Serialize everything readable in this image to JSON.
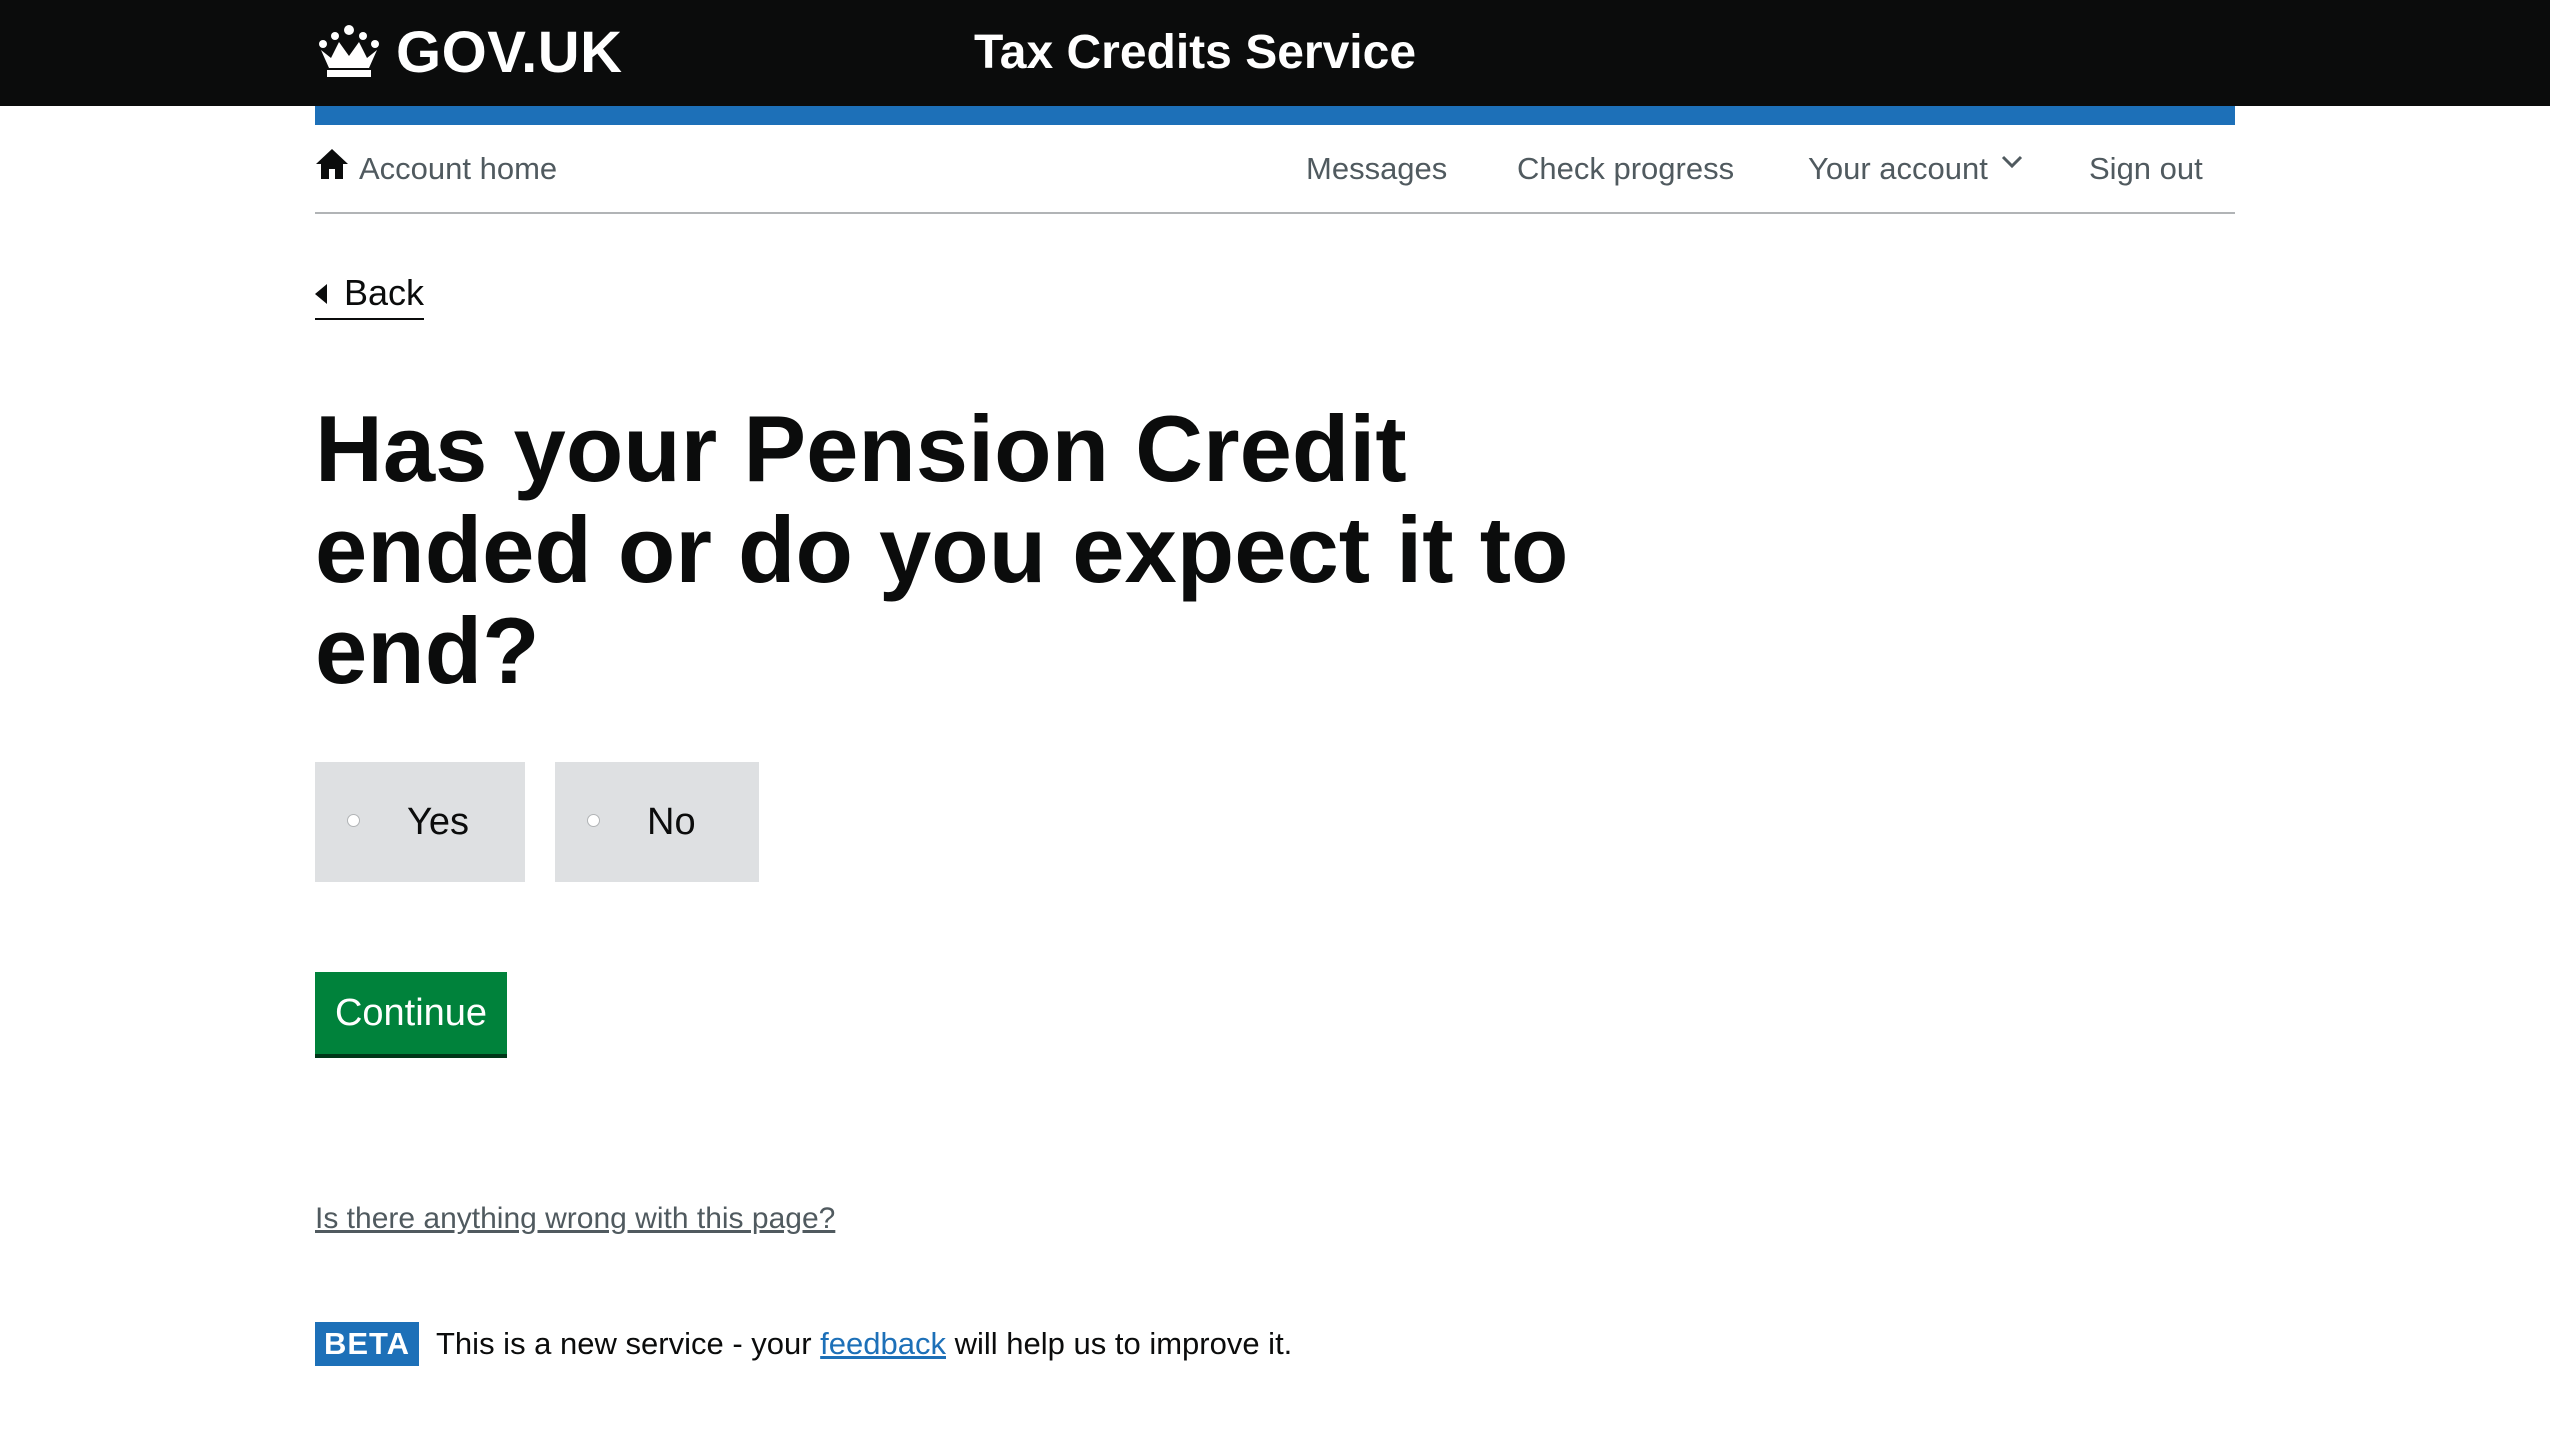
{
  "header": {
    "logo_text": "GOV.UK",
    "service_name": "Tax Credits Service",
    "accent_color": "#1d70b8"
  },
  "subnav": {
    "home_label": "Account home",
    "messages_label": "Messages",
    "progress_label": "Check progress",
    "account_label": "Your account",
    "signout_label": "Sign out"
  },
  "back_label": "Back",
  "question": "Has your Pension Credit ended or do you expect it to end?",
  "options": [
    {
      "label": "Yes",
      "selected": false
    },
    {
      "label": "No",
      "selected": false
    }
  ],
  "continue_label": "Continue",
  "continue_color": "#00823b",
  "problem_link": "Is there anything wrong with this page?",
  "beta": {
    "tag": "BETA",
    "text_before": "This is a new service  - your ",
    "link": "feedback",
    "text_after": " will help us to improve it."
  },
  "icons": {
    "logo": "crown-icon",
    "home": "home-icon",
    "account_menu": "chevron-down-icon",
    "back": "back-arrow-icon"
  }
}
